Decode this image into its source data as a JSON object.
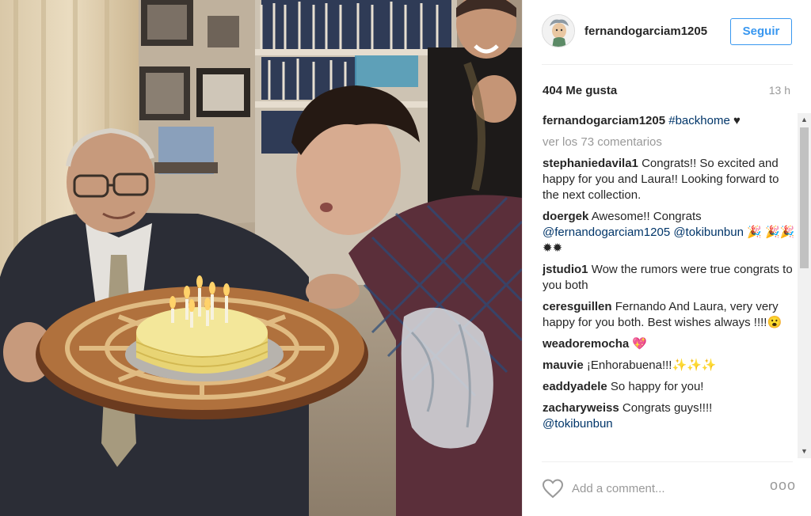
{
  "post": {
    "username": "fernandogarciam1205",
    "follow_label": "Seguir",
    "likes": "404 Me gusta",
    "time": "13 h",
    "caption": {
      "user": "fernandogarciam1205",
      "hashtag": "#backhome",
      "emoji": "♥"
    },
    "view_all_comments": "ver los 73 comentarios",
    "comments": [
      {
        "user": "stephaniedavila1",
        "text": "Congrats!! So excited and happy for you and Laura!! Looking forward to the next collection."
      },
      {
        "user": "doergek",
        "text": "Awesome!! Congrats",
        "mentions": "@fernandogarciam1205 @tokibunbun",
        "emoji": "🎉 🎉🎉 ✹✹"
      },
      {
        "user": "jstudio1",
        "text": "Wow the rumors were true congrats to you both"
      },
      {
        "user": "ceresguillen",
        "text": "Fernando And Laura, very very happy for you both. Best wishes always !!!!😮"
      },
      {
        "user": "weadoremocha",
        "text": "💖"
      },
      {
        "user": "mauvie",
        "text": "¡Enhorabuena!!!✨✨✨"
      },
      {
        "user": "eaddyadele",
        "text": "So happy for you!"
      },
      {
        "user": "zacharyweiss",
        "text": "Congrats guys!!!!",
        "mentions": "@tokibunbun"
      }
    ],
    "add_comment_placeholder": "Add a comment...",
    "more_label": "ooo"
  },
  "colors": {
    "accent": "#3897f0",
    "link": "#003569",
    "muted": "#999999"
  }
}
